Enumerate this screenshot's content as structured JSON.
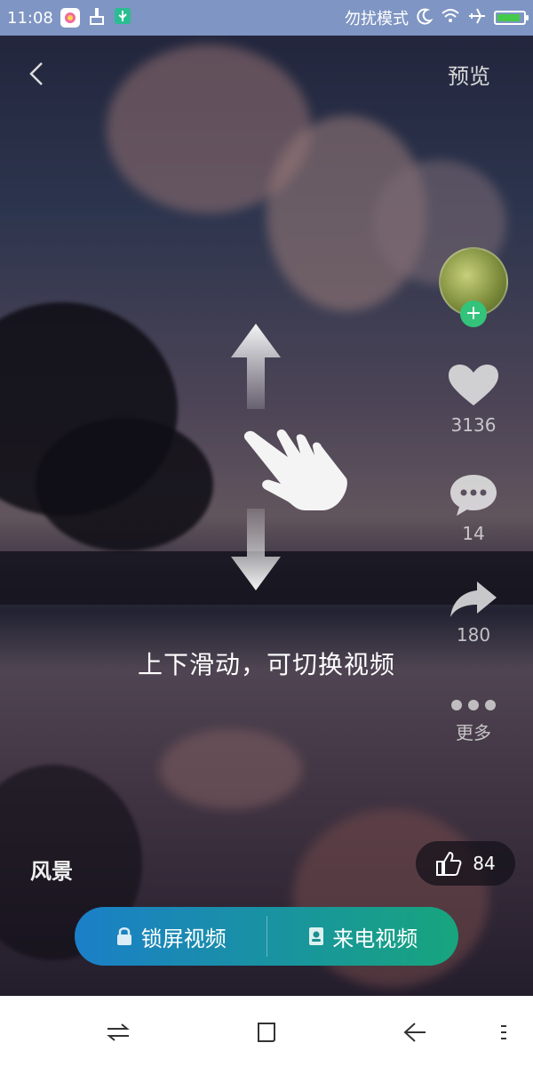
{
  "status_bar": {
    "time": "11:08",
    "dnd_label": "勿扰模式",
    "icons": [
      "app-icon",
      "clean-icon",
      "usb-icon",
      "moon-icon",
      "wifi-icon",
      "airplane-icon",
      "battery-icon"
    ],
    "battery_level": 0.9,
    "battery_color": "#45c94a"
  },
  "header": {
    "back_icon": "chevron-left-icon",
    "preview_label": "预览"
  },
  "actions": {
    "avatar_icon": "avatar",
    "follow_symbol": "+",
    "like_count": "3136",
    "comment_count": "14",
    "share_count": "180",
    "more_label": "更多"
  },
  "guide": {
    "text": "上下滑动，可切换视频",
    "icons": [
      "arrow-up-icon",
      "hand-swipe-icon",
      "arrow-down-icon"
    ]
  },
  "video": {
    "category": "风景",
    "likes": "84"
  },
  "bottom_bar": {
    "lockscreen_label": "锁屏视频",
    "callvideo_label": "来电视频",
    "colors": {
      "start": "#1b7fc8",
      "end": "#17a57d"
    }
  },
  "nav": {
    "icons": [
      "switch-apps-icon",
      "home-icon",
      "back-icon",
      "menu-icon"
    ]
  }
}
